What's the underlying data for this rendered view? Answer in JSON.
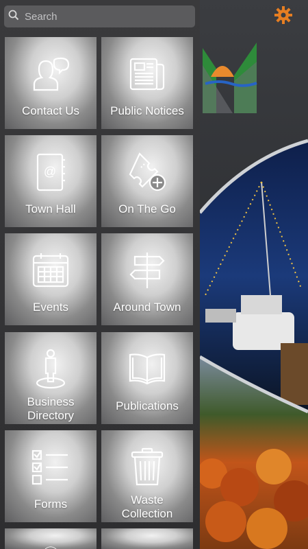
{
  "search": {
    "placeholder": "Search",
    "value": ""
  },
  "tiles": [
    {
      "label": "Contact Us",
      "icon": "contact-icon"
    },
    {
      "label": "Public Notices",
      "icon": "newspaper-icon"
    },
    {
      "label": "Town Hall",
      "icon": "address-book-icon"
    },
    {
      "label": "On The Go",
      "icon": "ticket-add-icon"
    },
    {
      "label": "Events",
      "icon": "calendar-icon"
    },
    {
      "label": "Around Town",
      "icon": "signpost-icon"
    },
    {
      "label": "Business\nDirectory",
      "icon": "person-pin-icon"
    },
    {
      "label": "Publications",
      "icon": "book-icon"
    },
    {
      "label": "Forms",
      "icon": "checklist-icon"
    },
    {
      "label": "Waste\nCollection",
      "icon": "trash-icon"
    }
  ],
  "colors": {
    "accent": "#e67e22",
    "tile_label": "#ffffff"
  }
}
